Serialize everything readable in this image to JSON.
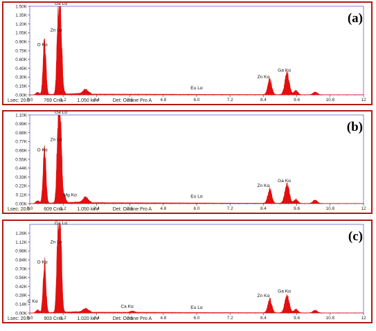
{
  "chart_data": [
    {
      "type": "area",
      "panel_label": "(a)",
      "x_ticks": [
        0.0,
        1.2,
        2.4,
        3.6,
        4.8,
        6.0,
        7.2,
        8.4,
        9.6,
        10.8,
        12.0
      ],
      "x_tick_labels": [
        "0.0",
        "1.2",
        "2.4",
        "3.6",
        "4.8",
        "6.0",
        "7.2",
        "8.4",
        "9.6",
        "10.8",
        "12"
      ],
      "xlim": [
        0,
        12
      ],
      "ylim": [
        0,
        1500
      ],
      "y_ticks": [
        0,
        150,
        300,
        450,
        600,
        750,
        900,
        1050,
        1200,
        1350,
        1500
      ],
      "y_tick_labels": [
        "0.00K",
        "0.15K",
        "0.30K",
        "0.45K",
        "0.60K",
        "0.75K",
        "0.90K",
        "1.05K",
        "1.20K",
        "1.35K",
        "1.50K"
      ],
      "peaks": [
        {
          "energy": 0.53,
          "counts": 950,
          "width": 0.05
        },
        {
          "energy": 0.28,
          "counts": 40,
          "width": 0.06
        },
        {
          "energy": 1.01,
          "counts": 1020,
          "width": 0.045
        },
        {
          "energy": 1.1,
          "counts": 1450,
          "width": 0.05
        },
        {
          "energy": 1.2,
          "counts": 60,
          "width": 0.05
        },
        {
          "energy": 2.0,
          "counts": 70,
          "width": 0.08
        },
        {
          "energy": 8.63,
          "counts": 250,
          "width": 0.07
        },
        {
          "energy": 9.25,
          "counts": 350,
          "width": 0.08
        },
        {
          "energy": 9.57,
          "counts": 70,
          "width": 0.07
        },
        {
          "energy": 10.26,
          "counts": 45,
          "width": 0.08
        }
      ],
      "background": 14,
      "annotations": [
        {
          "text": "Ga Lα",
          "energy": 1.12,
          "counts": 1500
        },
        {
          "text": "Zn Lα",
          "energy": 0.95,
          "counts": 1050
        },
        {
          "text": "O  Kα",
          "energy": 0.45,
          "counts": 805
        },
        {
          "text": "Eu Lα",
          "energy": 6.0,
          "counts": 70
        },
        {
          "text": "Zn Kα",
          "energy": 8.4,
          "counts": 260
        },
        {
          "text": "Ga Kα",
          "energy": 9.15,
          "counts": 370
        }
      ],
      "status": {
        "lsec": "Lsec: 20.0",
        "cnts": "769 Cnts",
        "kev": "1.050 keV",
        "det": "Det: Octane Pro A"
      }
    },
    {
      "type": "area",
      "panel_label": "(b)",
      "x_ticks": [
        0.0,
        1.2,
        2.4,
        3.6,
        4.8,
        6.0,
        7.2,
        8.4,
        9.6,
        10.8,
        12.0
      ],
      "x_tick_labels": [
        "0.0",
        "1.2",
        "2.4",
        "3.6",
        "4.8",
        "6.0",
        "7.2",
        "8.4",
        "9.6",
        "10.8",
        "12"
      ],
      "xlim": [
        0,
        12
      ],
      "ylim": [
        0,
        1100
      ],
      "y_ticks": [
        0,
        110,
        220,
        330,
        440,
        550,
        660,
        770,
        880,
        990,
        1100
      ],
      "y_tick_labels": [
        "0.00K",
        "0.11K",
        "0.22K",
        "0.33K",
        "0.44K",
        "0.55K",
        "0.66K",
        "0.77K",
        "0.88K",
        "0.99K",
        "1.10K"
      ],
      "peaks": [
        {
          "energy": 0.53,
          "counts": 690,
          "width": 0.05
        },
        {
          "energy": 0.28,
          "counts": 35,
          "width": 0.06
        },
        {
          "energy": 1.01,
          "counts": 760,
          "width": 0.045
        },
        {
          "energy": 1.1,
          "counts": 1010,
          "width": 0.05
        },
        {
          "energy": 1.25,
          "counts": 70,
          "width": 0.05
        },
        {
          "energy": 2.0,
          "counts": 60,
          "width": 0.08
        },
        {
          "energy": 8.63,
          "counts": 180,
          "width": 0.07
        },
        {
          "energy": 9.25,
          "counts": 230,
          "width": 0.08
        },
        {
          "energy": 9.57,
          "counts": 50,
          "width": 0.07
        },
        {
          "energy": 10.26,
          "counts": 40,
          "width": 0.08
        }
      ],
      "background": 12,
      "annotations": [
        {
          "text": "Ga Lα",
          "energy": 1.12,
          "counts": 1100
        },
        {
          "text": "Zn Lα",
          "energy": 0.95,
          "counts": 760
        },
        {
          "text": "O  Kα",
          "energy": 0.45,
          "counts": 630
        },
        {
          "text": "Mg Kα",
          "energy": 1.45,
          "counts": 75
        },
        {
          "text": "Eu Lα",
          "energy": 6.0,
          "counts": 55
        },
        {
          "text": "Zn Kα",
          "energy": 8.4,
          "counts": 190
        },
        {
          "text": "Ga Kα",
          "energy": 9.15,
          "counts": 250
        }
      ],
      "status": {
        "lsec": "Lsec: 20.0",
        "cnts": "609 Cnts",
        "kev": "1.050 keV",
        "det": "Det: Octane Pro A"
      }
    },
    {
      "type": "area",
      "panel_label": "(c)",
      "x_ticks": [
        0.0,
        1.2,
        2.4,
        3.6,
        4.8,
        6.0,
        7.2,
        8.4,
        9.6,
        10.8,
        12.0
      ],
      "x_tick_labels": [
        "0.0",
        "1.2",
        "2.4",
        "3.6",
        "4.8",
        "6.0",
        "7.2",
        "8.4",
        "9.6",
        "10.8",
        "12"
      ],
      "xlim": [
        0,
        12
      ],
      "ylim": [
        0,
        1400
      ],
      "y_ticks": [
        0,
        140,
        280,
        420,
        560,
        700,
        840,
        980,
        1120,
        1260
      ],
      "y_tick_labels": [
        "0.00K",
        "0.14K",
        "0.28K",
        "0.42K",
        "0.56K",
        "0.70K",
        "0.84K",
        "0.98K",
        "1.12K",
        "1.26K"
      ],
      "peaks": [
        {
          "energy": 0.28,
          "counts": 45,
          "width": 0.06
        },
        {
          "energy": 0.53,
          "counts": 780,
          "width": 0.05
        },
        {
          "energy": 1.01,
          "counts": 1070,
          "width": 0.045
        },
        {
          "energy": 1.1,
          "counts": 1330,
          "width": 0.05
        },
        {
          "energy": 2.0,
          "counts": 50,
          "width": 0.08
        },
        {
          "energy": 3.69,
          "counts": 22,
          "width": 0.07
        },
        {
          "energy": 8.63,
          "counts": 210,
          "width": 0.07
        },
        {
          "energy": 9.25,
          "counts": 270,
          "width": 0.08
        },
        {
          "energy": 9.57,
          "counts": 55,
          "width": 0.07
        },
        {
          "energy": 10.26,
          "counts": 40,
          "width": 0.08
        }
      ],
      "background": 13,
      "annotations": [
        {
          "text": "Ga Lα",
          "energy": 1.12,
          "counts": 1380
        },
        {
          "text": "Zn Lα",
          "energy": 0.95,
          "counts": 1080
        },
        {
          "text": "O  Kα",
          "energy": 0.45,
          "counts": 760
        },
        {
          "text": "C  Kα",
          "energy": 0.1,
          "counts": 140
        },
        {
          "text": "Ca Kα",
          "energy": 3.5,
          "counts": 60
        },
        {
          "text": "Eu Lα",
          "energy": 6.0,
          "counts": 45
        },
        {
          "text": "Zn Kα",
          "energy": 8.4,
          "counts": 230
        },
        {
          "text": "Ga Kα",
          "energy": 9.15,
          "counts": 300
        }
      ],
      "status": {
        "lsec": "Lsec: 20.0",
        "cnts": "903 Cnts",
        "kev": "1.020 keV",
        "det": "Det: Octane Pro A"
      }
    }
  ],
  "colors": {
    "spectrum": "#e01010",
    "frame": "#b01a12",
    "axis_box": "#2a2ac0"
  }
}
